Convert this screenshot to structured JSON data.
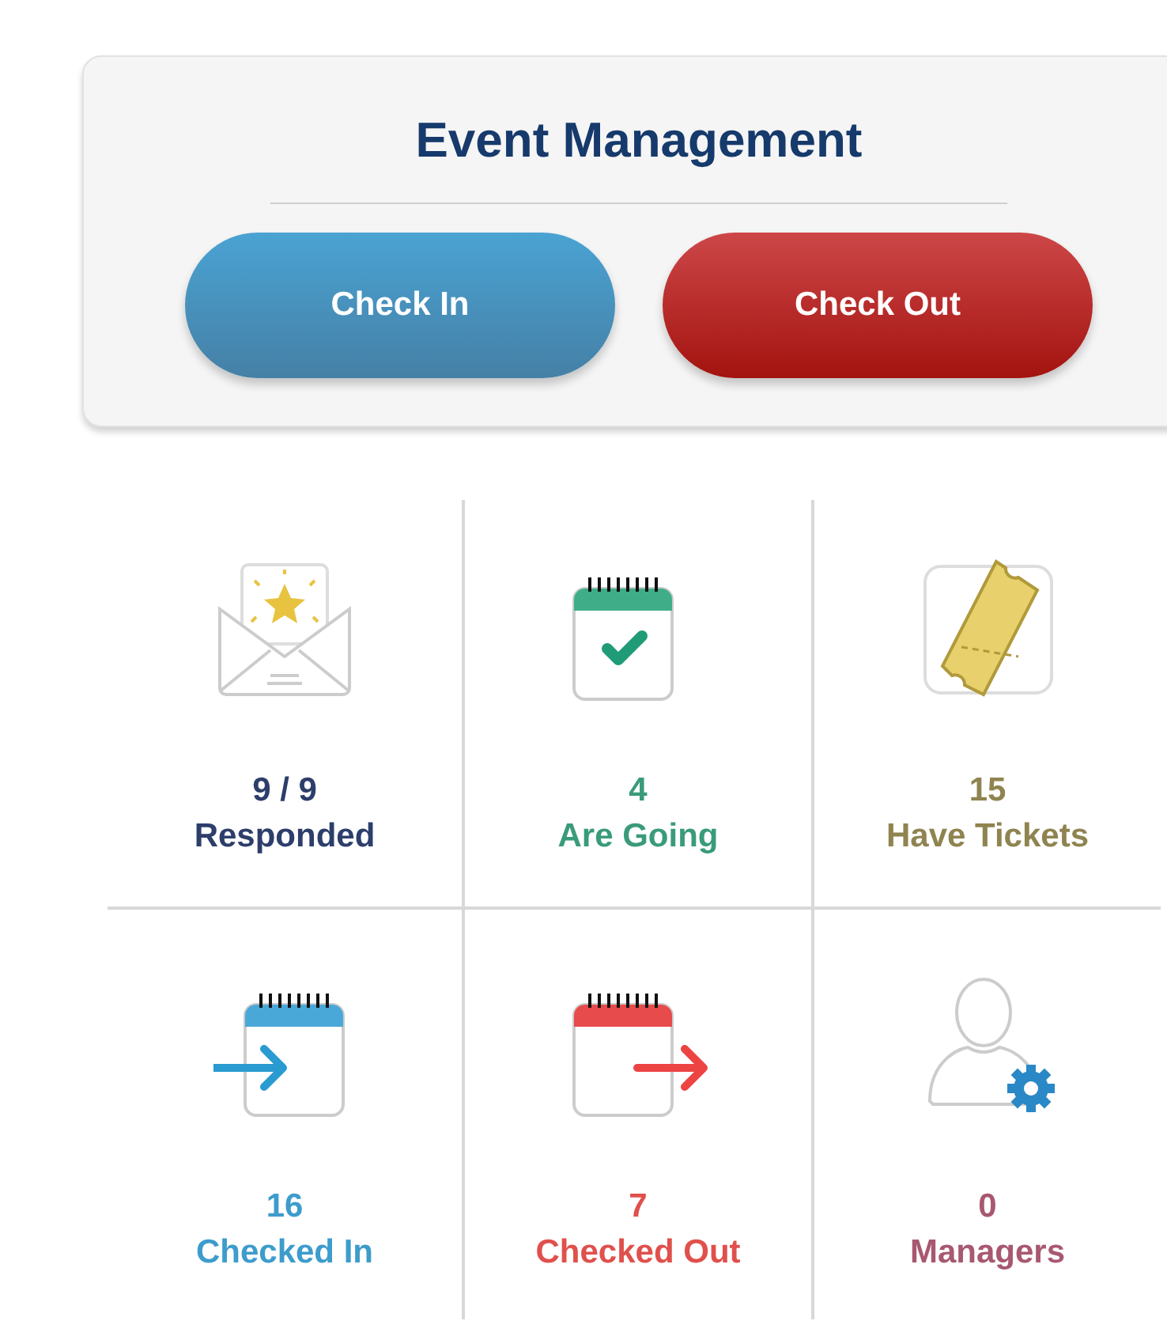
{
  "header": {
    "title": "Event Management",
    "buttons": [
      {
        "label": "Check In",
        "kind": "primary"
      },
      {
        "label": "Check Out",
        "kind": "danger"
      }
    ]
  },
  "stats": [
    {
      "kind": "envelope",
      "value": "9 / 9",
      "label": "Responded",
      "color": "#2d3e6b"
    },
    {
      "kind": "calendar-check",
      "value": "4",
      "label": "Are Going",
      "color": "#3a9b7a"
    },
    {
      "kind": "ticket",
      "value": "15",
      "label": "Have Tickets",
      "color": "#8f8450"
    },
    {
      "kind": "calendar-in",
      "value": "16",
      "label": "Checked In",
      "color": "#3d9ccc"
    },
    {
      "kind": "calendar-out",
      "value": "7",
      "label": "Checked Out",
      "color": "#e0504c"
    },
    {
      "kind": "user-gear",
      "value": "0",
      "label": "Managers",
      "color": "#a85870"
    }
  ]
}
